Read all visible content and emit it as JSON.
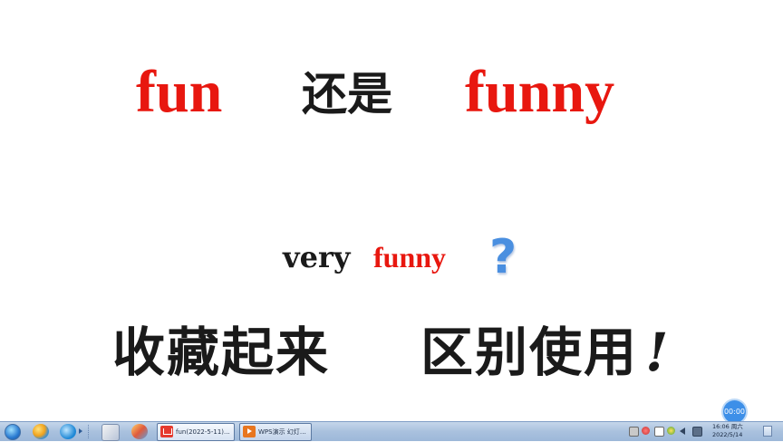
{
  "slide": {
    "title": {
      "word1": "fun",
      "word2": "还是",
      "word3": "funny"
    },
    "subtitle": {
      "word1": "very",
      "word2": "funny",
      "question": "?"
    },
    "bottom": {
      "left": "收藏起来",
      "right": "区别使用",
      "exclaim": "!"
    }
  },
  "recording": {
    "time": "00:00"
  },
  "taskbar": {
    "start_icon": "windows-orb-icon",
    "pinned": [
      "colorful-ball-icon",
      "internet-explorer-icon",
      "tool-icon",
      "paint-icon"
    ],
    "tasks": [
      {
        "label": "fun(2022-5-11)...",
        "icon": "wps-writer-icon",
        "active": true
      },
      {
        "label": "WPS演示 幻灯片...",
        "icon": "wps-presentation-icon",
        "active": false
      }
    ],
    "tray_icons": [
      "action-center-icon",
      "antivirus-icon",
      "document-icon",
      "network-icon",
      "volume-icon",
      "keyboard-icon"
    ],
    "clock": {
      "time": "16:06 周六",
      "date": "2022/5/14"
    }
  },
  "colors": {
    "accent_red": "#e8170f",
    "text_black": "#1a1a1a",
    "question_blue": "#4a8fe0",
    "taskbar_blue": "#a9c1de"
  }
}
